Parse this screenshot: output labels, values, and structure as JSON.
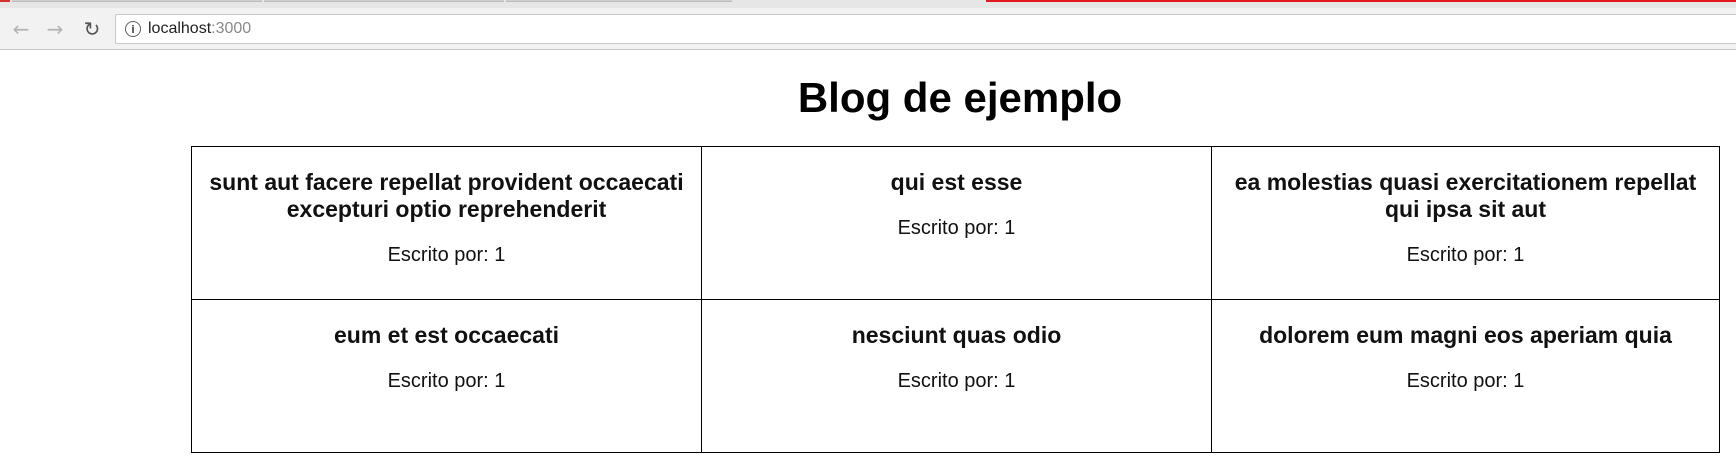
{
  "browser": {
    "url_host": "localhost",
    "url_port": ":3000",
    "icons": {
      "back": "arrow-left-icon",
      "forward": "arrow-right-icon",
      "reload": "reload-icon",
      "site_info": "info-icon"
    },
    "accent_color": "#e3171f"
  },
  "page": {
    "title": "Blog de ejemplo"
  },
  "posts": [
    {
      "title": "sunt aut facere repellat provident occaecati excepturi optio reprehenderit",
      "author_label": "Escrito por: 1"
    },
    {
      "title": "qui est esse",
      "author_label": "Escrito por: 1"
    },
    {
      "title": "ea molestias quasi exercitationem repellat qui ipsa sit aut",
      "author_label": "Escrito por: 1"
    },
    {
      "title": "eum et est occaecati",
      "author_label": "Escrito por: 1"
    },
    {
      "title": "nesciunt quas odio",
      "author_label": "Escrito por: 1"
    },
    {
      "title": "dolorem eum magni eos aperiam quia",
      "author_label": "Escrito por: 1"
    }
  ]
}
